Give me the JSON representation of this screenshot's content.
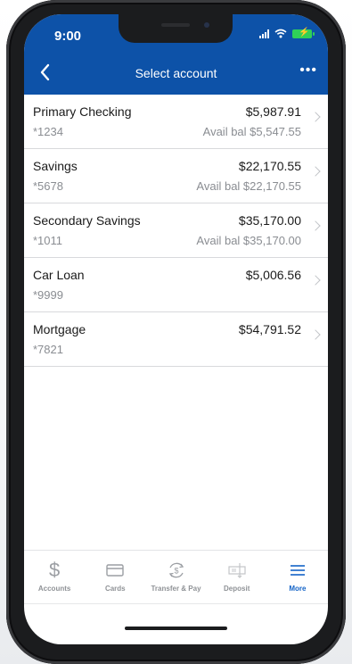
{
  "status": {
    "time": "9:00"
  },
  "header": {
    "title": "Select account"
  },
  "accounts": [
    {
      "name": "Primary Checking",
      "number": "*1234",
      "balance": "$5,987.91",
      "available": "Avail bal $5,547.55"
    },
    {
      "name": "Savings",
      "number": "*5678",
      "balance": "$22,170.55",
      "available": "Avail bal $22,170.55"
    },
    {
      "name": "Secondary Savings",
      "number": "*1011",
      "balance": "$35,170.00",
      "available": "Avail bal $35,170.00"
    },
    {
      "name": "Car Loan",
      "number": "*9999",
      "balance": "$5,006.56",
      "available": ""
    },
    {
      "name": "Mortgage",
      "number": "*7821",
      "balance": "$54,791.52",
      "available": ""
    }
  ],
  "tabs": [
    {
      "label": "Accounts",
      "icon": "dollar-icon"
    },
    {
      "label": "Cards",
      "icon": "card-icon"
    },
    {
      "label": "Transfer & Pay",
      "icon": "transfer-icon"
    },
    {
      "label": "Deposit",
      "icon": "check-deposit-icon"
    },
    {
      "label": "More",
      "icon": "menu-icon"
    }
  ],
  "colors": {
    "header": "#0d52a8",
    "active_tab": "#1363c7"
  }
}
